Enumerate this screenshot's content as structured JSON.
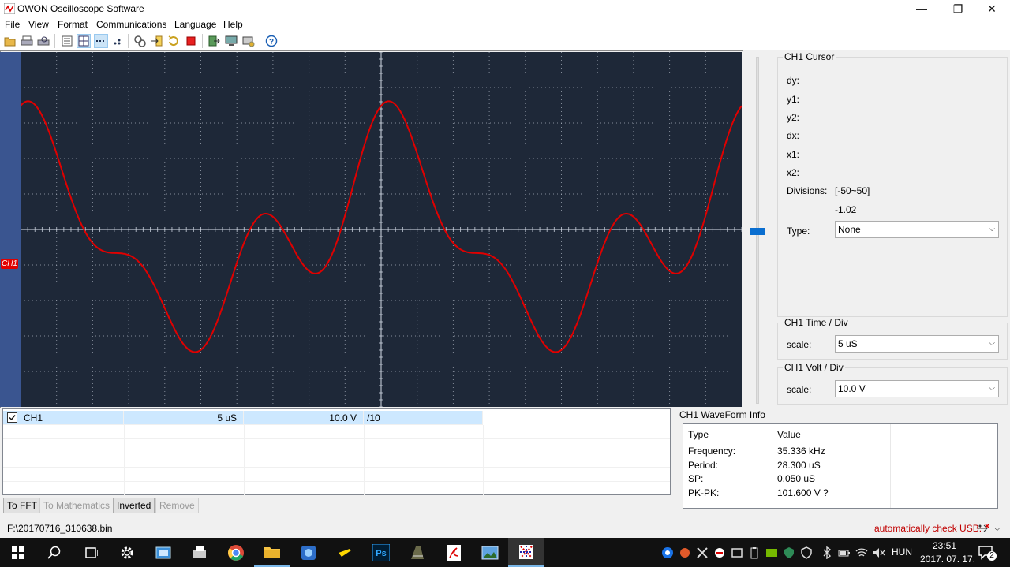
{
  "window": {
    "title": "OWON Oscilloscope Software",
    "minimize": "—",
    "maximize": "❐",
    "close": "✕"
  },
  "menu": [
    "File",
    "View",
    "Format",
    "Communications",
    "Language",
    "Help"
  ],
  "channel_marker": "CH1",
  "cursor_panel": {
    "title": "CH1 Cursor",
    "labels": [
      "dy:",
      "y1:",
      "y2:",
      "dx:",
      "x1:",
      "x2:"
    ],
    "divisions_label": "Divisions:",
    "divisions_range": "[-50~50]",
    "divisions_value": "-1.02",
    "type_label": "Type:",
    "type_value": "None"
  },
  "time_panel": {
    "title": "CH1 Time / Div",
    "scale_label": "scale:",
    "scale_value": "5  uS"
  },
  "volt_panel": {
    "title": "CH1 Volt / Div",
    "scale_label": "scale:",
    "scale_value": "10.0 V"
  },
  "channel_table": {
    "rows": [
      {
        "checked": true,
        "name": "CH1",
        "time": "5  uS",
        "volt": "10.0 V",
        "probe": "/10"
      }
    ]
  },
  "buttons": {
    "fft": "To FFT",
    "math": "To Mathematics",
    "inverted": "Inverted",
    "remove": "Remove"
  },
  "waveform_info": {
    "title": "CH1 WaveForm Info",
    "header": [
      "Type",
      "Value"
    ],
    "rows": [
      [
        "Frequency:",
        "35.336 kHz"
      ],
      [
        "Period:",
        "28.300 uS"
      ],
      [
        "SP:",
        "0.050 uS"
      ],
      [
        "PK-PK:",
        "101.600 V ?"
      ]
    ]
  },
  "status": {
    "file": "F:\\20170716_310638.bin",
    "usb": "automatically check USB:"
  },
  "taskbar": {
    "lang": "HUN",
    "time": "23:51",
    "date": "2017. 07. 17.",
    "notifications": "2"
  },
  "colors": {
    "trace": "#e00000",
    "scope_bg": "#1e2838",
    "grid": "#c8d0dc",
    "accent": "#0a6ed0",
    "usb_text": "#c00000"
  }
}
